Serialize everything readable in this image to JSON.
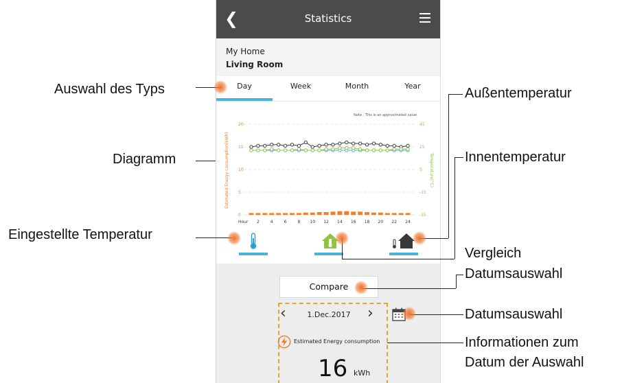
{
  "app": {
    "title": "Statistics",
    "back_icon": "chevron-left-icon",
    "menu_icon": "hamburger-menu-icon"
  },
  "location": {
    "home": "My Home",
    "room": "Living Room"
  },
  "tabs": [
    {
      "label": "Day",
      "active": true
    },
    {
      "label": "Week",
      "active": false
    },
    {
      "label": "Month",
      "active": false
    },
    {
      "label": "Year",
      "active": false
    }
  ],
  "chart_data": {
    "type": "line",
    "note": "Note : This is an approximated value",
    "ylabel_left": "Estimated Energy consumption(kWh)",
    "ylabel_right": "Temperature(°C)",
    "x_axis_label": "Hour",
    "x_ticks": [
      "2",
      "4",
      "6",
      "8",
      "10",
      "12",
      "14",
      "16",
      "18",
      "20",
      "22",
      "24"
    ],
    "left_ticks": [
      "20",
      "15",
      "10",
      "5",
      "0"
    ],
    "right_ticks": [
      "45",
      "25",
      "5",
      "-15",
      "-35"
    ],
    "ylim_left": [
      0,
      20
    ],
    "ylim_right": [
      -35,
      45
    ],
    "grid": true,
    "x": [
      1,
      2,
      3,
      4,
      5,
      6,
      7,
      8,
      9,
      10,
      11,
      12,
      13,
      14,
      15,
      16,
      17,
      18,
      19,
      20,
      21,
      22,
      23,
      24
    ],
    "series": [
      {
        "axis": "left",
        "type": "bar",
        "color": "#f07f2c",
        "values": [
          0.4,
          0.4,
          0.4,
          0.4,
          0.4,
          0.4,
          0.4,
          0.4,
          0.5,
          0.5,
          0.6,
          0.6,
          0.7,
          0.8,
          0.8,
          0.7,
          0.7,
          0.6,
          0.5,
          0.5,
          0.4,
          0.4,
          0.4,
          0.4
        ]
      },
      {
        "axis": "right",
        "type": "line",
        "color": "#3a3a3a",
        "values": [
          25,
          26,
          26,
          27,
          27,
          26,
          27,
          26,
          29,
          25,
          26,
          27,
          27,
          28,
          29,
          28,
          28,
          27,
          28,
          27,
          26,
          26,
          25,
          26
        ]
      },
      {
        "axis": "right",
        "type": "line",
        "color": "#5aaee0",
        "values": [
          22,
          22,
          22,
          22,
          22,
          22,
          22,
          22,
          22,
          22,
          22,
          22,
          22,
          22,
          22,
          22,
          22,
          22,
          22,
          22,
          22,
          22,
          22,
          22
        ]
      },
      {
        "axis": "right",
        "type": "line",
        "color": "#8cc63f",
        "values": [
          22,
          22,
          22,
          23,
          22,
          22,
          22,
          23,
          22,
          22,
          22,
          23,
          23,
          24,
          24,
          24,
          23,
          22,
          22,
          22,
          22,
          23,
          23,
          23
        ]
      }
    ]
  },
  "modes": [
    {
      "icon": "thermometer-icon",
      "color": "#2a9fd6",
      "selected": true
    },
    {
      "icon": "indoor-house-icon",
      "color": "#8cc63f",
      "selected": true
    },
    {
      "icon": "outdoor-house-icon",
      "color": "#3a3a3a",
      "selected": true
    }
  ],
  "compare": {
    "label": "Compare"
  },
  "date": {
    "label": "1.Dec.2017",
    "calendar_icon": "calendar-icon"
  },
  "energy": {
    "icon": "lightning-icon",
    "label": "Estimated Energy consumption",
    "value": "16",
    "unit": "kWh"
  },
  "callouts": {
    "type_selection": "Auswahl des Typs",
    "diagram": "Diagramm",
    "set_temperature": "Eingestellte Temperatur",
    "outside_temp": "Außentemperatur",
    "inside_temp": "Innentemperatur",
    "compare_line1": "Vergleich",
    "compare_line2": "Datumsauswahl",
    "date_selection": "Datumsauswahl",
    "info_line1": "Informationen zum",
    "info_line2": "Datum der Auswahl"
  },
  "colors": {
    "topbar": "#4b4b4b",
    "accent": "#4db3d6",
    "energy_orange": "#f07f2c",
    "temp_green": "#8cc63f",
    "dashed_box": "#f0a030"
  }
}
